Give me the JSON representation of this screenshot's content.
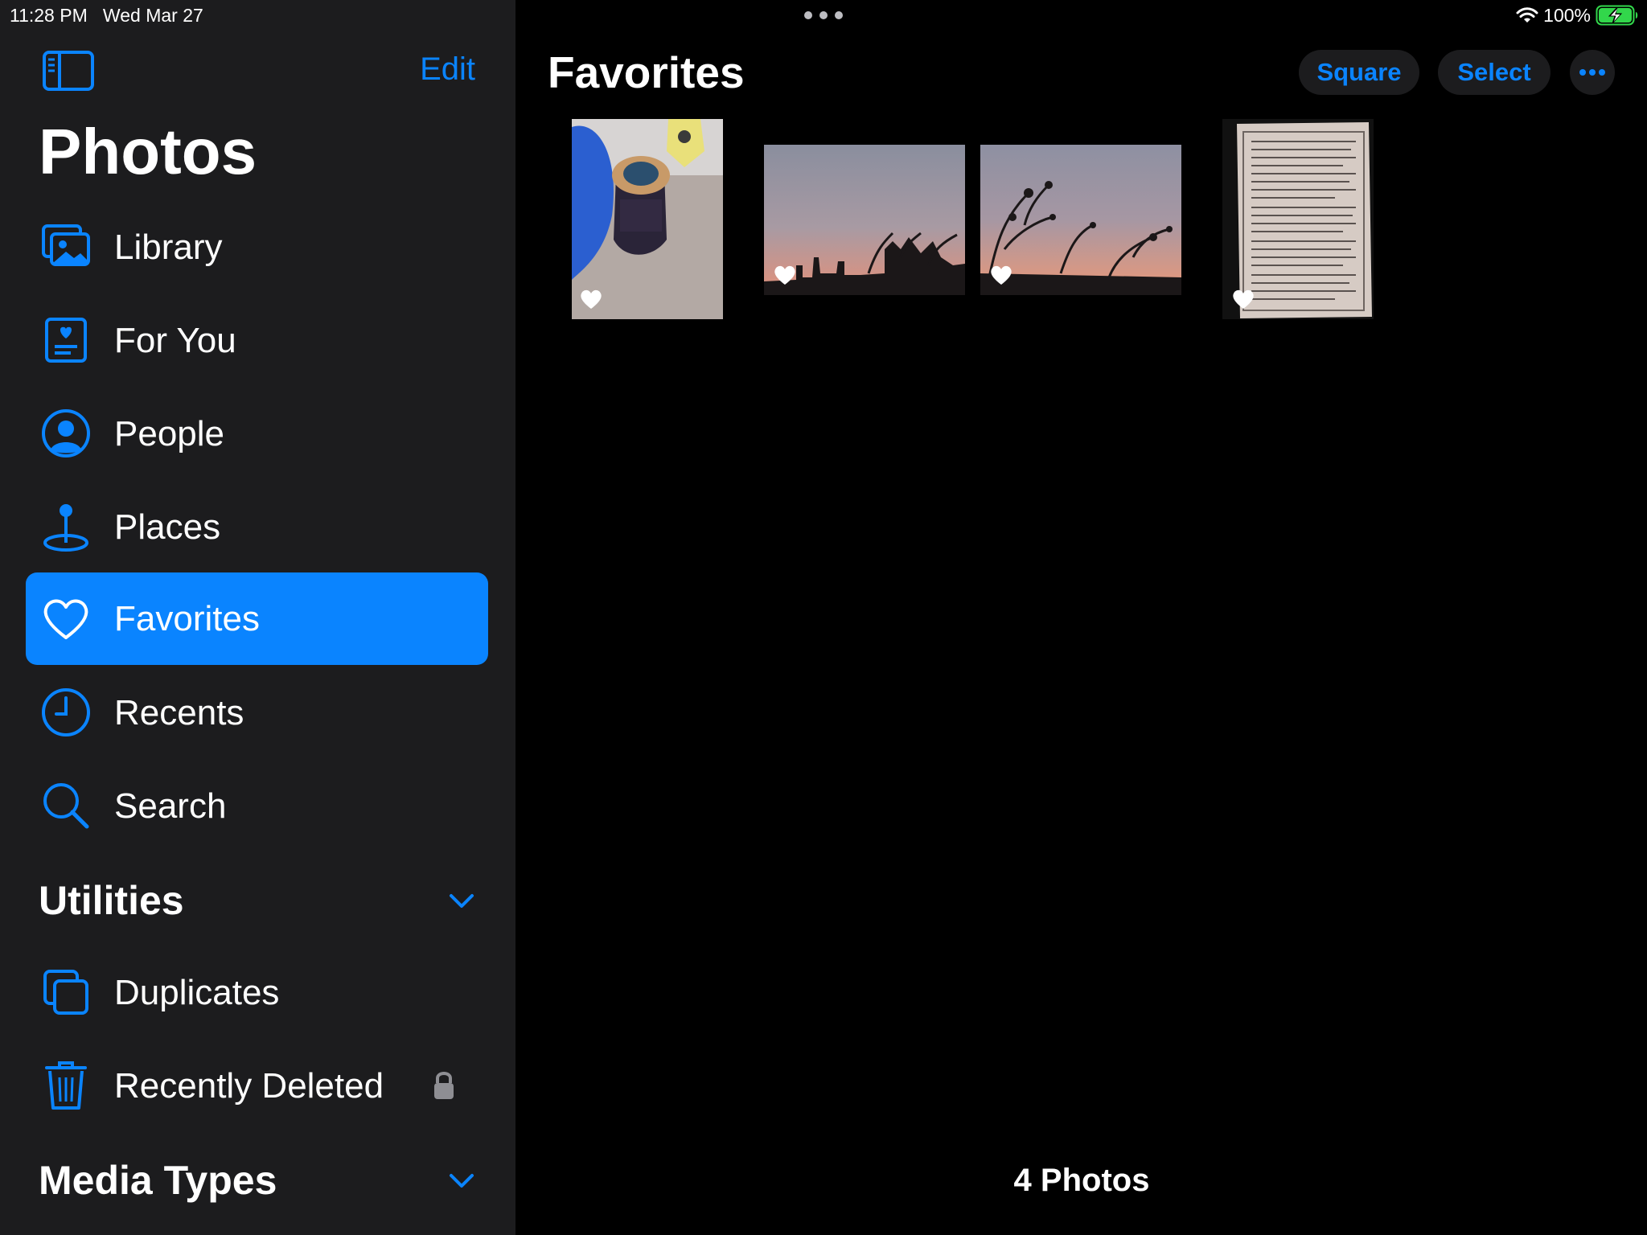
{
  "status_bar": {
    "time": "11:28 PM",
    "date": "Wed Mar 27",
    "battery_percent": "100%",
    "battery_level": 1.0,
    "charging": true
  },
  "colors": {
    "accent": "#0a84ff",
    "sidebar_bg": "#1c1c1e",
    "main_bg": "#000000",
    "battery_green": "#32d74b"
  },
  "sidebar": {
    "edit_label": "Edit",
    "title": "Photos",
    "items": [
      {
        "label": "Library",
        "icon": "photo-library-icon",
        "selected": false
      },
      {
        "label": "For You",
        "icon": "for-you-icon",
        "selected": false
      },
      {
        "label": "People",
        "icon": "person-circle-icon",
        "selected": false
      },
      {
        "label": "Places",
        "icon": "map-pin-icon",
        "selected": false
      },
      {
        "label": "Favorites",
        "icon": "heart-icon",
        "selected": true
      },
      {
        "label": "Recents",
        "icon": "clock-icon",
        "selected": false
      },
      {
        "label": "Search",
        "icon": "search-icon",
        "selected": false
      }
    ],
    "utilities": {
      "title": "Utilities",
      "items": [
        {
          "label": "Duplicates",
          "icon": "duplicates-icon"
        },
        {
          "label": "Recently Deleted",
          "icon": "trash-icon",
          "locked": true
        }
      ]
    },
    "media_types": {
      "title": "Media Types"
    }
  },
  "main": {
    "title": "Favorites",
    "square_label": "Square",
    "select_label": "Select",
    "more_icon": "ellipsis-icon",
    "photos": [
      {
        "subject": "jar-on-table",
        "favorite": true
      },
      {
        "subject": "sunset-skyline",
        "favorite": true
      },
      {
        "subject": "sunset-branches",
        "favorite": true
      },
      {
        "subject": "printed-document",
        "favorite": true
      }
    ],
    "photo_count": "4 Photos"
  }
}
